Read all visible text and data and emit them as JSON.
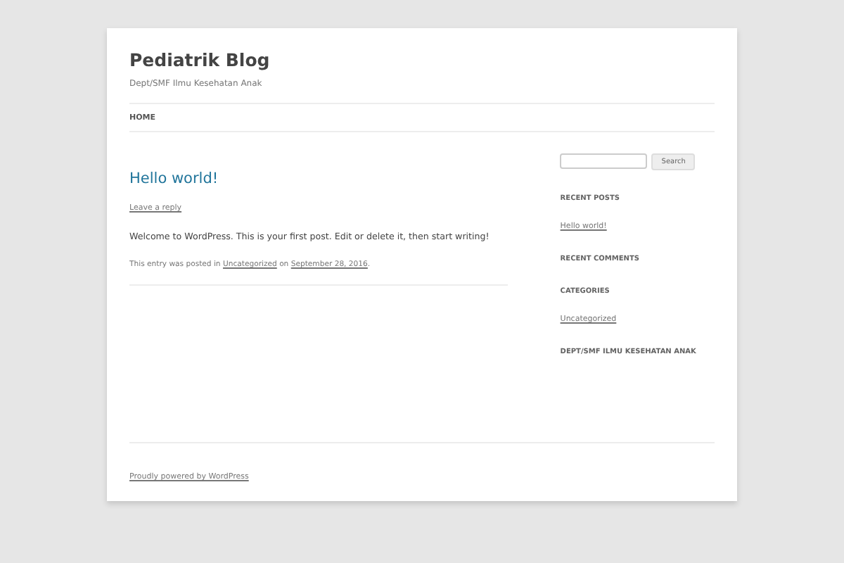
{
  "site": {
    "title": "Pediatrik Blog",
    "tagline": "Dept/SMF Ilmu Kesehatan Anak"
  },
  "nav": [
    {
      "label": "HOME",
      "selected": false
    }
  ],
  "post": {
    "title": "Hello world!",
    "reply_link": "Leave a reply",
    "body": "Welcome to WordPress. This is your first post. Edit or delete it, then start writing!",
    "meta_prefix": "This entry was posted in",
    "category": "Uncategorized",
    "meta_on": "on",
    "date": "September 28, 2016",
    "meta_end": "."
  },
  "sidebar": {
    "search_button": "Search",
    "widgets": [
      {
        "title": "RECENT POSTS",
        "links": [
          "Hello world!"
        ]
      },
      {
        "title": "RECENT COMMENTS"
      },
      {
        "title": "CATEGORIES",
        "links": [
          "Uncategorized"
        ]
      },
      {
        "title": "DEPT/SMF ILMU KESEHATAN ANAK"
      }
    ]
  },
  "footer": {
    "credit": "Proudly powered by WordPress"
  }
}
